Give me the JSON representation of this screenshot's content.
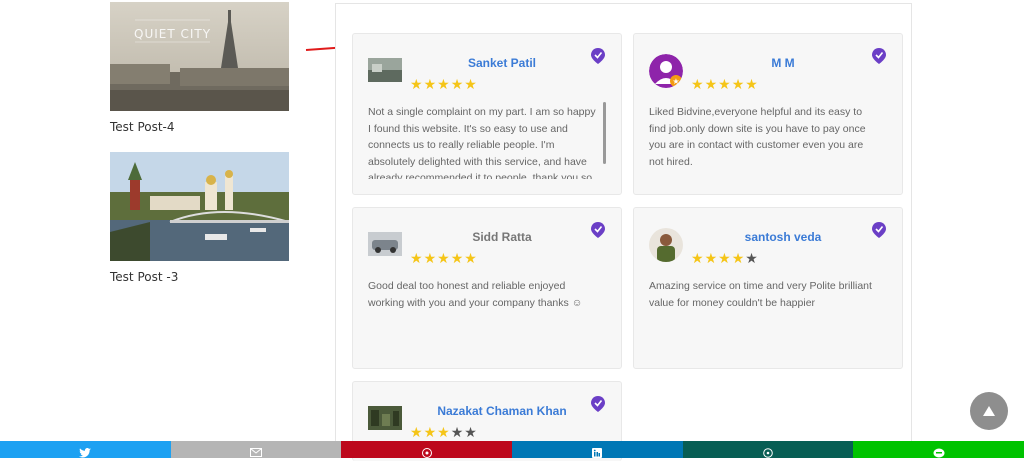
{
  "sidebar": {
    "posts": [
      {
        "title": "Test Post-4",
        "image_caption": "QUIET CITY"
      },
      {
        "title": "Test Post -3"
      }
    ]
  },
  "reviews": [
    {
      "name": "Sanket Patil",
      "rating": 5,
      "text": "Not a single complaint on my part. I am so happy I found this website. It's so easy to use and connects us to really reliable people. I'm absolutely delighted with this service, and have already recommended it to people, thank you so"
    },
    {
      "name": "M M",
      "rating": 5,
      "text": "Liked Bidvine,everyone helpful and its easy to find job.only down site is you have to pay once you are in contact with customer even you are not hired."
    },
    {
      "name": "Sidd Ratta",
      "rating": 5,
      "text": "Good deal too honest and reliable enjoyed working with you and your company thanks ☺"
    },
    {
      "name": "santosh veda",
      "rating": 4,
      "text": "Amazing service on time and very Polite brilliant value for money couldn't be happier"
    },
    {
      "name": "Nazakat Chaman Khan",
      "rating": 3,
      "text": ""
    }
  ],
  "colors": {
    "accent_blue": "#3b7bd6",
    "star_on": "#f5c518",
    "star_off": "#555555",
    "badge_purple": "#6b3fc6"
  },
  "share_bar": [
    {
      "network": "twitter",
      "icon": "twitter-icon",
      "color": "#1da1f2"
    },
    {
      "network": "email",
      "icon": "mail-icon",
      "color": "#b5b5b5"
    },
    {
      "network": "pinterest",
      "icon": "pinterest-icon",
      "color": "#bd081c"
    },
    {
      "network": "linkedin",
      "icon": "linkedin-icon",
      "color": "#0077b5"
    },
    {
      "network": "whatsapp",
      "icon": "whatsapp-icon",
      "color": "#075e54"
    },
    {
      "network": "line",
      "icon": "line-icon",
      "color": "#00c300"
    }
  ]
}
